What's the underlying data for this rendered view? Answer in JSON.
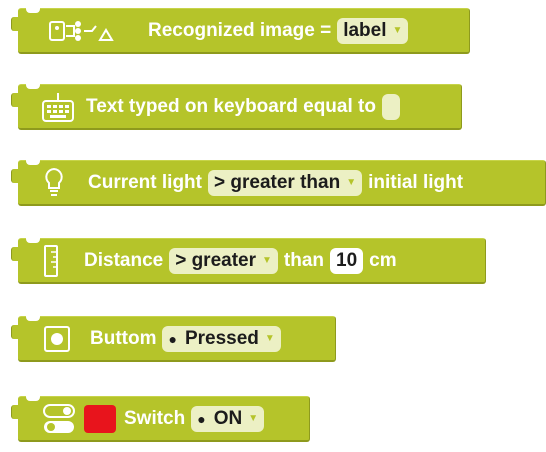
{
  "blocks": [
    {
      "text": "Recognized image =",
      "dropdown": "label",
      "icon": "robot-scan-icon"
    },
    {
      "text": "Text typed on keyboard equal to",
      "icon": "keyboard-icon"
    },
    {
      "text": "Current light",
      "dropdown": "> greater than",
      "text2": "initial light",
      "icon": "light-bulb-icon"
    },
    {
      "text": "Distance",
      "dropdown": "> greater",
      "text2": "than",
      "number": "10",
      "text3": "cm",
      "icon": "ruler-icon"
    },
    {
      "text": "Buttom",
      "bullet": "●",
      "dropdown": "Pressed",
      "icon": "button-icon"
    },
    {
      "text": "Switch",
      "bullet": "●",
      "dropdown": "ON",
      "icon": "toggle-switch-icon",
      "swatch_color": "#e8141c"
    }
  ],
  "colors": {
    "block": "#b5c42a",
    "field": "#ecf0c4",
    "text": "#ffffff"
  },
  "dropdown_arrow": "▼"
}
